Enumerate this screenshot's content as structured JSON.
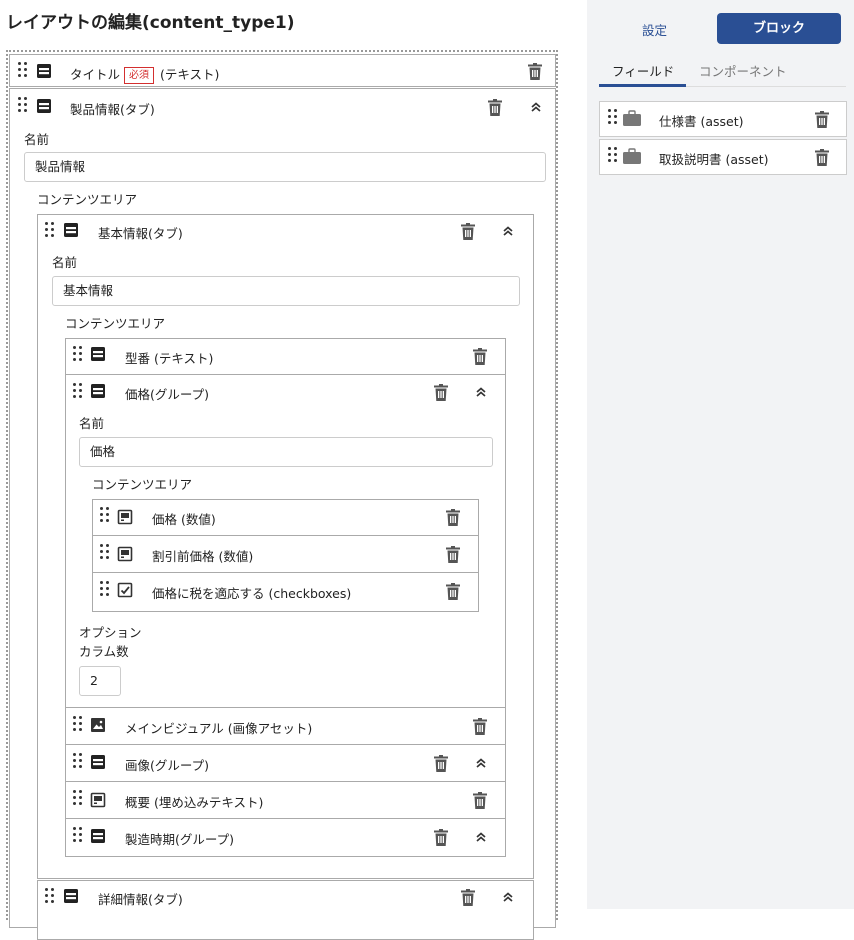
{
  "page_title": "レイアウトの編集(content_type1)",
  "main": {
    "title_row": {
      "label": "タイトル",
      "required": "必須",
      "type": "(テキスト)"
    },
    "product_tab": {
      "label": "製品情報(タブ)",
      "name_label": "名前",
      "name_value": "製品情報",
      "content_area": "コンテンツエリア",
      "basic_tab": {
        "label": "基本情報(タブ)",
        "name_label": "名前",
        "name_value": "基本情報",
        "content_area": "コンテンツエリア",
        "model_row": "型番 (テキスト)",
        "price_group": {
          "label": "価格(グループ)",
          "name_label": "名前",
          "name_value": "価格",
          "content_area": "コンテンツエリア",
          "items": [
            "価格 (数値)",
            "割引前価格 (数値)",
            "価格に税を適応する (checkboxes)"
          ],
          "options_label": "オプション",
          "columns_label": "カラム数",
          "columns_value": "2"
        },
        "main_visual": "メインビジュアル (画像アセット)",
        "image_group": "画像(グループ)",
        "overview": "概要 (埋め込みテキスト)",
        "manufacture_group": "製造時期(グループ)"
      },
      "detail_tab": "詳細情報(タブ)"
    }
  },
  "sidebar": {
    "settings_tab": "設定",
    "block_button": "ブロック",
    "tab_field": "フィールド",
    "tab_component": "コンポーネント",
    "items": [
      "仕様書 (asset)",
      "取扱説明書 (asset)"
    ]
  },
  "colors": {
    "accent": "#2a4f94",
    "required": "#d32f2f"
  }
}
